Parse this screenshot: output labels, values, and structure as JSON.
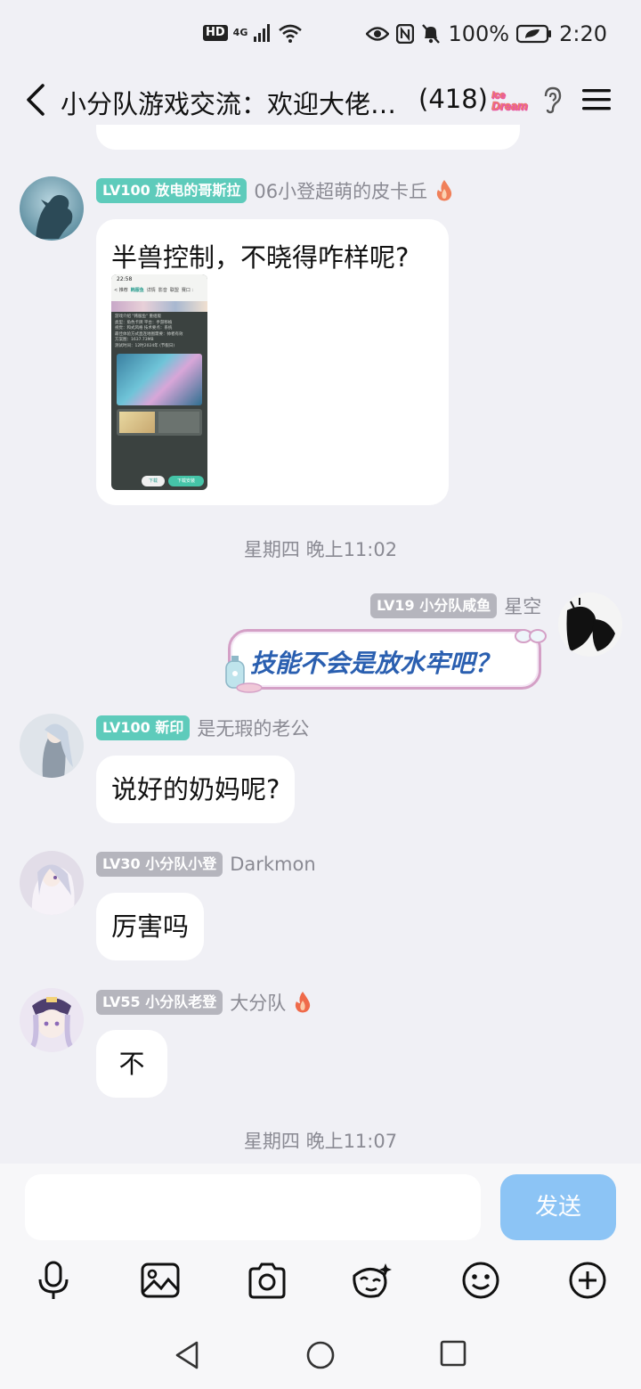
{
  "status_bar": {
    "hd": "HD",
    "network": "4G",
    "battery": "100%",
    "time": "2:20"
  },
  "header": {
    "title": "小分队游戏交流：欢迎大佬…",
    "member_count": "(418)",
    "badge_text": "Ice Dream"
  },
  "messages": [
    {
      "level_badge": "LV100 放电的哥斯拉",
      "nick": "06小登超萌的皮卡丘",
      "text": "半兽控制，不晓得咋样呢?",
      "has_image": true,
      "image_header": "22:58",
      "image_tabs": [
        "< 推荐",
        "韩服鱼",
        "详情",
        "影音",
        "联盟",
        "赛口 :"
      ],
      "image_lines": [
        "游戏介绍 \"韩服鱼\" 重组版",
        "类型：角色卡牌  平台：手游移植",
        "视觉：和式风格  技术要点：系统",
        "最佳体验方式直连地图需要：帅者有效",
        "方案图：1637.73MB",
        "测试时间：12时2024年 (节假日)"
      ],
      "image_footer": [
        "下载",
        "下载安装"
      ]
    },
    {
      "timestamp": "星期四 晚上11:02"
    },
    {
      "level_badge": "LV19 小分队咸鱼",
      "nick": "星空",
      "text": "技能不会是放水牢吧？",
      "self": true
    },
    {
      "level_badge": "LV100 新印",
      "nick": "是无瑕的老公",
      "text": "说好的奶妈呢?"
    },
    {
      "level_badge": "LV30 小分队小登",
      "nick": "Darkmon",
      "text": "厉害吗"
    },
    {
      "level_badge": "LV55 小分队老登",
      "nick": "大分队",
      "text": "不"
    },
    {
      "timestamp": "星期四 晚上11:07"
    }
  ],
  "input": {
    "placeholder": "",
    "send_label": "发送"
  },
  "toolbar": [
    "microphone-icon",
    "image-icon",
    "camera-icon",
    "mask-sticker-icon",
    "emoji-icon",
    "plus-icon"
  ],
  "colors": {
    "background": "#f0f0f5",
    "teal_badge": "#5ecbbb",
    "gray_badge": "#b5b5bd",
    "send_button": "#8cc4f5",
    "fancy_text": "#2a5fb0"
  }
}
